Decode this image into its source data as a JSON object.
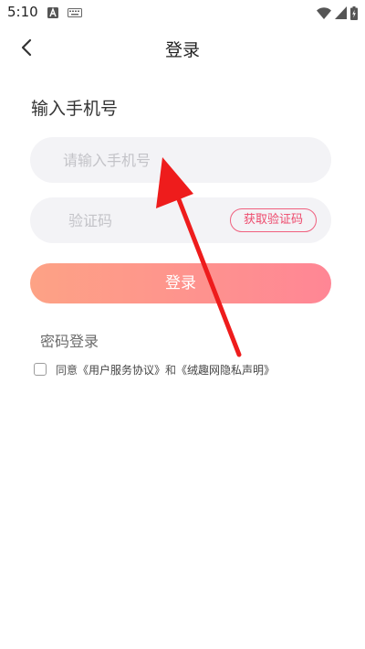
{
  "status_bar": {
    "time": "5:10",
    "icons": [
      "notification-a-icon",
      "keyboard-icon",
      "wifi-icon",
      "cellular-signal-icon",
      "battery-charging-icon"
    ]
  },
  "nav": {
    "title": "登录",
    "back_icon": "chevron-left-icon"
  },
  "section_title": "输入手机号",
  "phone_input": {
    "placeholder": "请输入手机号",
    "value": ""
  },
  "code_input": {
    "placeholder": "验证码",
    "value": ""
  },
  "get_code_button_label": "获取验证码",
  "login_button_label": "登录",
  "password_login_label": "密码登录",
  "agreement": {
    "checked": false,
    "prefix": "同意",
    "user_agreement": "《用户服务协议》",
    "conjunction": "和",
    "privacy_policy": "《绒趣网隐私声明》"
  },
  "colors": {
    "accent": "#ee4a6c",
    "button_gradient_start": "#fda285",
    "button_gradient_end": "#ff8695",
    "input_background": "#f3f3f6",
    "annotation_arrow": "#ee1c1c"
  }
}
